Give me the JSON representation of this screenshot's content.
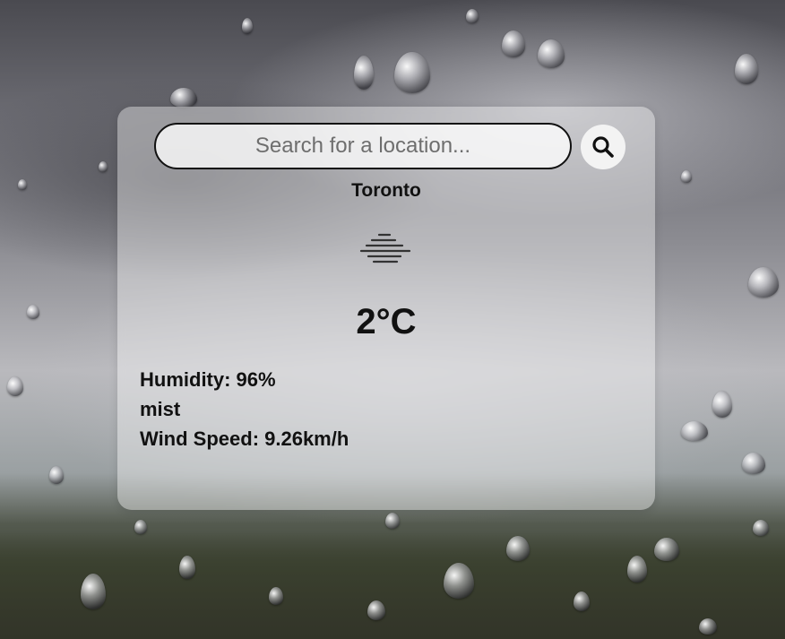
{
  "search": {
    "placeholder": "Search for a location..."
  },
  "weather": {
    "city": "Toronto",
    "condition_icon": "mist-icon",
    "temperature": "2°C",
    "humidity": "Humidity: 96%",
    "description": "mist",
    "wind_speed": "Wind Speed: 9.26km/h"
  },
  "icons": {
    "search_button": "search-icon"
  },
  "colors": {
    "text": "#111111",
    "card_background": "rgba(255,255,255,0.38)"
  }
}
